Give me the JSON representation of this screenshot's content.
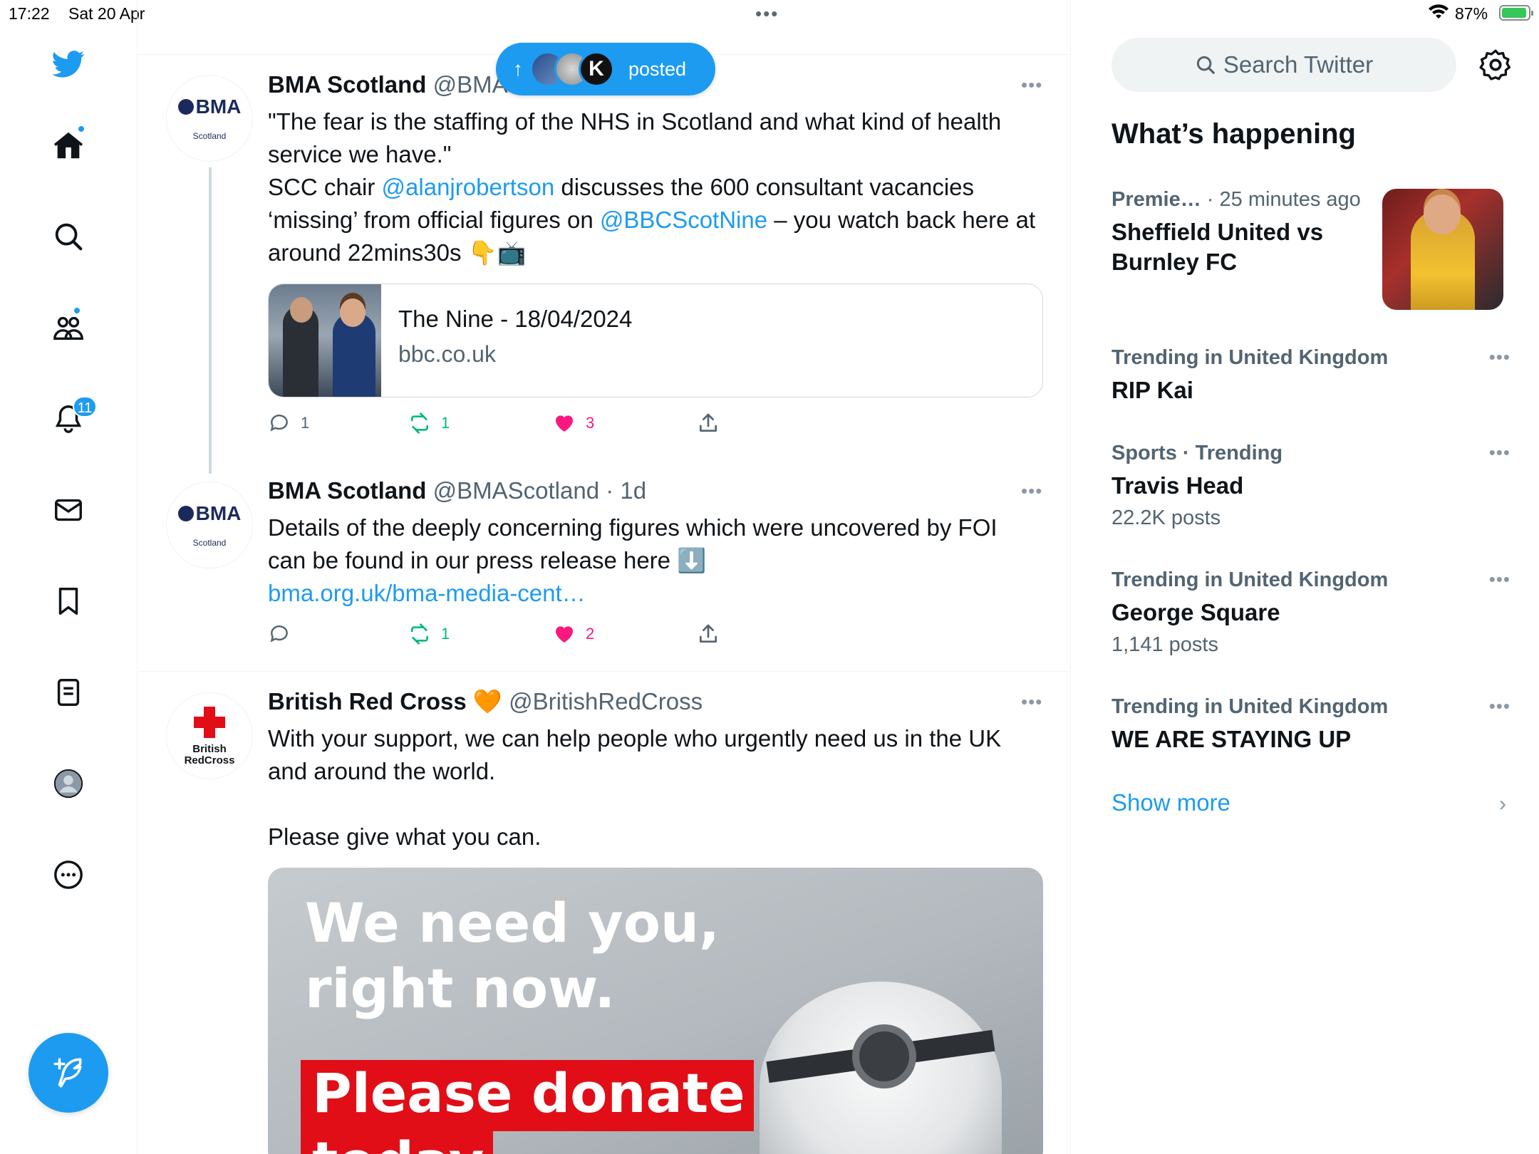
{
  "status_bar": {
    "time": "17:22",
    "date": "Sat 20 Apr",
    "battery": "87%",
    "multitask_dots": "•••",
    "icons": [
      "wifi-icon",
      "battery-charging-icon"
    ]
  },
  "nav": {
    "items": [
      {
        "name": "twitter-logo",
        "icon": "twitter-bird-icon"
      },
      {
        "name": "home",
        "icon": "home-icon",
        "has_dot": true
      },
      {
        "name": "explore",
        "icon": "search-icon"
      },
      {
        "name": "communities",
        "icon": "people-icon",
        "has_dot": true
      },
      {
        "name": "notifications",
        "icon": "bell-icon",
        "badge": "11"
      },
      {
        "name": "messages",
        "icon": "envelope-icon"
      },
      {
        "name": "bookmarks",
        "icon": "bookmark-icon"
      },
      {
        "name": "lists",
        "icon": "list-icon"
      },
      {
        "name": "profile",
        "icon": "avatar-icon"
      },
      {
        "name": "more",
        "icon": "more-circle-icon"
      }
    ],
    "compose_icon": "compose-feather-icon",
    "brand_color": "#1d9bf0"
  },
  "pill": {
    "arrow": "↑",
    "label": "posted"
  },
  "tweets": [
    {
      "name": "BMA Scotland",
      "handle": "@BMA",
      "avatar_logo": "BMA",
      "avatar_sub": "Scotland",
      "more": "•••",
      "body_line1": "\"The fear is the staffing of the NHS in Scotland and what kind of health service we have.\"",
      "body_l2_pre": "SCC chair ",
      "body_l2_link": "@alanjrobertson",
      "body_l2_mid": " discusses the 600 consultant vacancies ‘missing’ from official figures on ",
      "body_l2_link2": "@BBCScotNine",
      "body_l2_post": " – you watch back here at around 22mins30s 👇📺",
      "card": {
        "title": "The Nine - 18/04/2024",
        "domain": "bbc.co.uk"
      },
      "replies": "1",
      "retweets": "1",
      "likes": "3"
    },
    {
      "name": "BMA Scotland",
      "handle": "@BMAScotland",
      "time": "· 1d",
      "avatar_logo": "BMA",
      "avatar_sub": "Scotland",
      "more": "•••",
      "body": "Details of the deeply concerning figures which were uncovered by FOI can be found in our press release here ⬇️",
      "link": "bma.org.uk/bma-media-cent…",
      "retweets": "1",
      "likes": "2"
    },
    {
      "name": "British Red Cross 🧡",
      "handle": "@BritishRedCross",
      "avatar_l1": "British",
      "avatar_l2": "RedCross",
      "more": "•••",
      "body_p1": "With your support, we can help people who urgently need us in the UK and around the world.",
      "body_p2": "Please give what you can.",
      "media": {
        "line1": "We need you,",
        "line2": "right now.",
        "banner1": "Please donate",
        "banner2": "today."
      }
    }
  ],
  "right": {
    "search_placeholder": "Search Twitter",
    "title": "What’s happening",
    "trends": [
      {
        "category": "Premie…",
        "meta": " · 25 minutes ago",
        "name": "Sheffield United vs Burnley FC"
      },
      {
        "category": "Trending in United Kingdom",
        "name": "RIP Kai",
        "more": "•••"
      },
      {
        "category": "Sports · Trending",
        "name": "Travis Head",
        "count": "22.2K posts",
        "more": "•••"
      },
      {
        "category": "Trending in United Kingdom",
        "name": "George Square",
        "count": "1,141 posts",
        "more": "•••"
      },
      {
        "category": "Trending in United Kingdom",
        "name": "WE ARE STAYING UP",
        "more": "•••"
      }
    ],
    "show_more": "Show more",
    "chevron": "›"
  },
  "colors": {
    "accent": "#1d9bf0",
    "retweet": "#00ba7c",
    "like": "#f91880",
    "muted": "#536471"
  }
}
